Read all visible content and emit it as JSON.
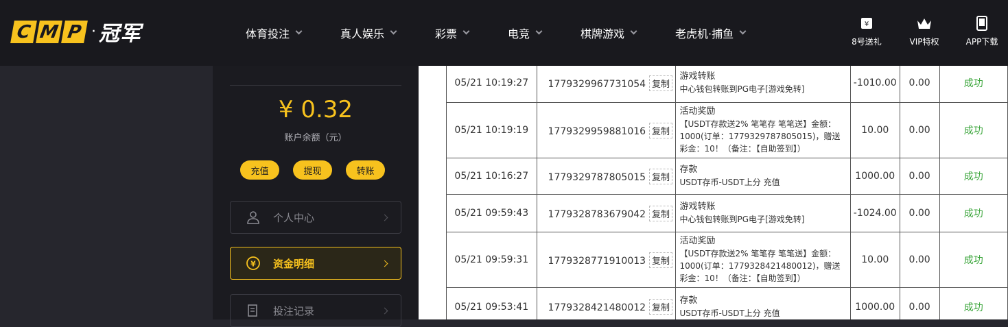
{
  "header": {
    "logo_letters": [
      "C",
      "M",
      "P"
    ],
    "logo_cn": "冠军",
    "nav": [
      {
        "label": "体育投注"
      },
      {
        "label": "真人娱乐"
      },
      {
        "label": "彩票"
      },
      {
        "label": "电竞"
      },
      {
        "label": "棋牌游戏"
      },
      {
        "label": "老虎机·捕鱼"
      }
    ],
    "tools": [
      {
        "label": "8号送礼",
        "icon": "gift-ticket-icon"
      },
      {
        "label": "VIP特权",
        "icon": "crown-icon"
      },
      {
        "label": "APP下载",
        "icon": "phone-icon"
      }
    ]
  },
  "account": {
    "balance": "¥ 0.32",
    "balance_label": "账户余额（元）",
    "actions": [
      "充值",
      "提现",
      "转账"
    ],
    "menu": [
      {
        "label": "个人中心",
        "icon": "user-icon",
        "active": false
      },
      {
        "label": "资金明细",
        "icon": "yen-coin-icon",
        "active": true
      },
      {
        "label": "投注记录",
        "icon": "document-icon",
        "active": false
      }
    ]
  },
  "records": {
    "copy_label": "复制",
    "rows": [
      {
        "time": "05/21 10:19:27",
        "id": "1779329967731054",
        "type": "游戏转账",
        "detail": "中心钱包转账到PG电子[游戏免转]",
        "amount": "-1010.00",
        "fee": "0.00",
        "status": "成功"
      },
      {
        "time": "05/21 10:19:19",
        "id": "1779329959881016",
        "type": "活动奖励",
        "detail": "【USDT存款送2% 笔笔存 笔笔送】金额：1000(订单：1779329787805015)，赠送彩金：10！（备注：【自助签到】）",
        "amount": "10.00",
        "fee": "0.00",
        "status": "成功"
      },
      {
        "time": "05/21 10:16:27",
        "id": "1779329787805015",
        "type": "存款",
        "detail": "USDT存币-USDT上分 充值",
        "amount": "1000.00",
        "fee": "0.00",
        "status": "成功"
      },
      {
        "time": "05/21 09:59:43",
        "id": "1779328783679042",
        "type": "游戏转账",
        "detail": "中心钱包转账到PG电子[游戏免转]",
        "amount": "-1024.00",
        "fee": "0.00",
        "status": "成功"
      },
      {
        "time": "05/21 09:59:31",
        "id": "1779328771910013",
        "type": "活动奖励",
        "detail": "【USDT存款送2% 笔笔存 笔笔送】金额：1000(订单：1779328421480012)，赠送彩金：10！（备注：【自助签到】）",
        "amount": "10.00",
        "fee": "0.00",
        "status": "成功"
      },
      {
        "time": "05/21 09:53:41",
        "id": "1779328421480012",
        "type": "存款",
        "detail": "USDT存币-USDT上分 充值",
        "amount": "1000.00",
        "fee": "0.00",
        "status": "成功"
      }
    ]
  },
  "colors": {
    "accent": "#f7c21e",
    "success": "#3aa53a",
    "topbar": "#19191e",
    "panel": "#1b1b20"
  }
}
